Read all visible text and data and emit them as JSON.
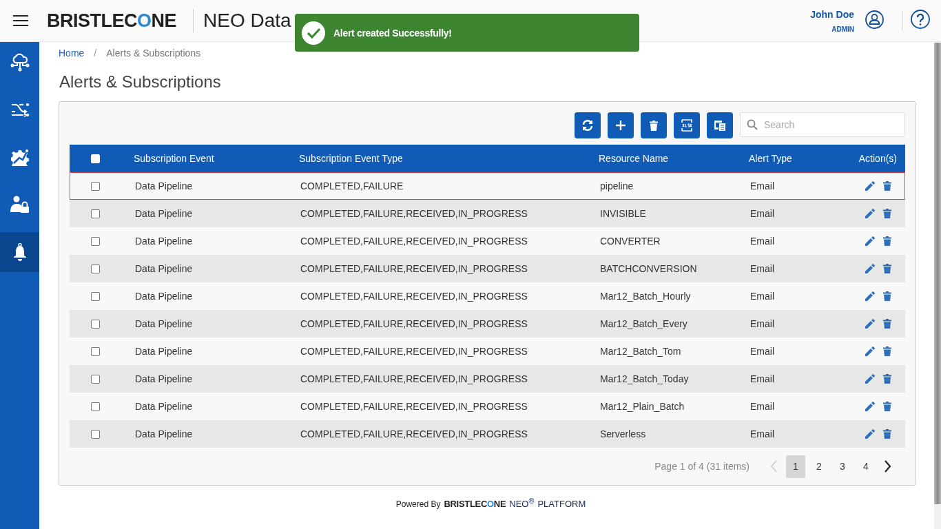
{
  "header": {
    "logo": "BRISTLECONE",
    "title": "NEO Data",
    "user_name": "John Doe",
    "user_role": "ADMIN"
  },
  "toast": {
    "kind": "success",
    "message": "Alert created Successfully!"
  },
  "sidebar": {
    "items": [
      {
        "kind": "cloud",
        "selected": false
      },
      {
        "kind": "shuffle",
        "selected": false
      },
      {
        "kind": "gear",
        "selected": false
      },
      {
        "kind": "user-lock",
        "selected": false
      },
      {
        "kind": "bell",
        "selected": true
      }
    ]
  },
  "breadcrumb": {
    "separator": "/",
    "items": [
      "Home",
      "Alerts & Subscriptions"
    ]
  },
  "page_title": "Alerts & Subscriptions",
  "toolbar": {
    "buttons": [
      {
        "kind": "refresh"
      },
      {
        "kind": "add"
      },
      {
        "kind": "delete"
      },
      {
        "kind": "xlsx"
      },
      {
        "kind": "columns"
      }
    ],
    "search": {
      "placeholder": "Search"
    }
  },
  "table": {
    "header_checked": false,
    "columns": [
      "Subscription Event",
      "Subscription Event Type",
      "Resource Name",
      "Alert Type",
      "Action(s)"
    ],
    "rows": [
      {
        "checked": false,
        "highlighted": true,
        "cells": [
          "Data Pipeline",
          "COMPLETED,FAILURE",
          "pipeline",
          "Email"
        ]
      },
      {
        "checked": false,
        "highlighted": false,
        "cells": [
          "Data Pipeline",
          "COMPLETED,FAILURE,RECEIVED,IN_PROGRESS",
          "INVISIBLE",
          "Email"
        ]
      },
      {
        "checked": false,
        "highlighted": false,
        "cells": [
          "Data Pipeline",
          "COMPLETED,FAILURE,RECEIVED,IN_PROGRESS",
          "CONVERTER",
          "Email"
        ]
      },
      {
        "checked": false,
        "highlighted": false,
        "cells": [
          "Data Pipeline",
          "COMPLETED,FAILURE,RECEIVED,IN_PROGRESS",
          "BATCHCONVERSION",
          "Email"
        ]
      },
      {
        "checked": false,
        "highlighted": false,
        "cells": [
          "Data Pipeline",
          "COMPLETED,FAILURE,RECEIVED,IN_PROGRESS",
          "Mar12_Batch_Hourly",
          "Email"
        ]
      },
      {
        "checked": false,
        "highlighted": false,
        "cells": [
          "Data Pipeline",
          "COMPLETED,FAILURE,RECEIVED,IN_PROGRESS",
          "Mar12_Batch_Every",
          "Email"
        ]
      },
      {
        "checked": false,
        "highlighted": false,
        "cells": [
          "Data Pipeline",
          "COMPLETED,FAILURE,RECEIVED,IN_PROGRESS",
          "Mar12_Batch_Tom",
          "Email"
        ]
      },
      {
        "checked": false,
        "highlighted": false,
        "cells": [
          "Data Pipeline",
          "COMPLETED,FAILURE,RECEIVED,IN_PROGRESS",
          "Mar12_Batch_Today",
          "Email"
        ]
      },
      {
        "checked": false,
        "highlighted": false,
        "cells": [
          "Data Pipeline",
          "COMPLETED,FAILURE,RECEIVED,IN_PROGRESS",
          "Mar12_Plain_Batch",
          "Email"
        ]
      },
      {
        "checked": false,
        "highlighted": false,
        "cells": [
          "Data Pipeline",
          "COMPLETED,FAILURE,RECEIVED,IN_PROGRESS",
          "Serverless",
          "Email"
        ]
      }
    ]
  },
  "pagination": {
    "summary": "Page 1 of 4 (31 items)",
    "prev_disabled": true,
    "pages": [
      {
        "label": "1",
        "selected": true
      },
      {
        "label": "2",
        "selected": false
      },
      {
        "label": "3",
        "selected": false
      },
      {
        "label": "4",
        "selected": false
      }
    ]
  },
  "footer": {
    "powered_by": "Powered By",
    "logo": "BRISTLECONE",
    "product": "NEO$^{®}$",
    "platform": "PLATFORM"
  }
}
